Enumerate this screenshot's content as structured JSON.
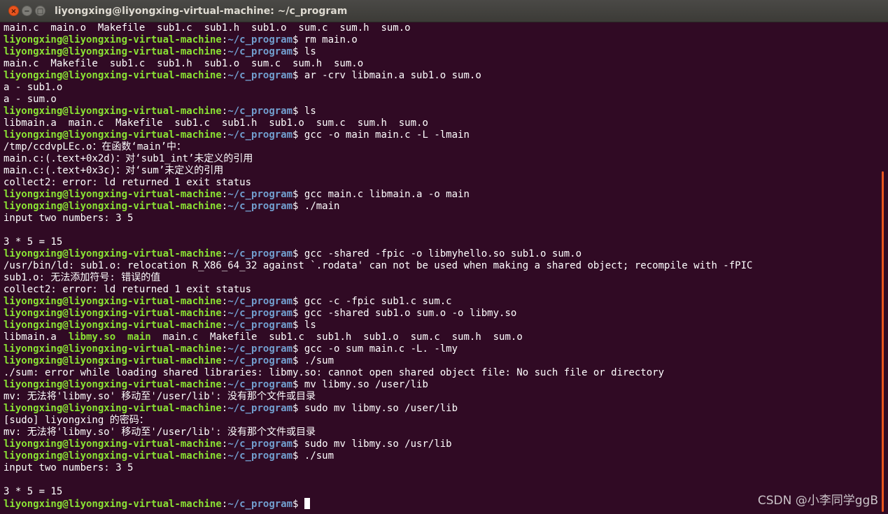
{
  "window": {
    "title": "liyongxing@liyongxing-virtual-machine: ~/c_program",
    "close_glyph": "×",
    "minimize_glyph": "−",
    "maximize_glyph": "□"
  },
  "prompt": {
    "user_host": "liyongxing@liyongxing-virtual-machine",
    "sep": ":",
    "path": "~/c_program",
    "symbol": "$ "
  },
  "lines": [
    {
      "type": "out",
      "text": "main.c  main.o  Makefile  sub1.c  sub1.h  sub1.o  sum.c  sum.h  sum.o"
    },
    {
      "type": "cmd",
      "text": "rm main.o"
    },
    {
      "type": "cmd",
      "text": "ls"
    },
    {
      "type": "out",
      "text": "main.c  Makefile  sub1.c  sub1.h  sub1.o  sum.c  sum.h  sum.o"
    },
    {
      "type": "cmd",
      "text": "ar -crv libmain.a sub1.o sum.o"
    },
    {
      "type": "out",
      "text": "a - sub1.o"
    },
    {
      "type": "out",
      "text": "a - sum.o"
    },
    {
      "type": "cmd",
      "text": "ls"
    },
    {
      "type": "out",
      "text": "libmain.a  main.c  Makefile  sub1.c  sub1.h  sub1.o  sum.c  sum.h  sum.o"
    },
    {
      "type": "cmd",
      "text": "gcc -o main main.c -L -lmain"
    },
    {
      "type": "out",
      "text": "/tmp/ccdvpLEc.o：在函数‘main’中："
    },
    {
      "type": "out",
      "text": "main.c:(.text+0x2d)：对‘sub1_int’未定义的引用"
    },
    {
      "type": "out",
      "text": "main.c:(.text+0x3c)：对‘sum’未定义的引用"
    },
    {
      "type": "out",
      "text": "collect2: error: ld returned 1 exit status"
    },
    {
      "type": "cmd",
      "text": "gcc main.c libmain.a -o main"
    },
    {
      "type": "cmd",
      "text": "./main"
    },
    {
      "type": "out",
      "text": "input two numbers: 3 5"
    },
    {
      "type": "out",
      "text": ""
    },
    {
      "type": "out",
      "text": "3 * 5 = 15"
    },
    {
      "type": "cmd",
      "text": "gcc -shared -fpic -o libmyhello.so sub1.o sum.o"
    },
    {
      "type": "out",
      "text": "/usr/bin/ld: sub1.o: relocation R_X86_64_32 against `.rodata' can not be used when making a shared object; recompile with -fPIC"
    },
    {
      "type": "out",
      "text": "sub1.o: 无法添加符号: 错误的值"
    },
    {
      "type": "out",
      "text": "collect2: error: ld returned 1 exit status"
    },
    {
      "type": "cmd",
      "text": "gcc -c -fpic sub1.c sum.c"
    },
    {
      "type": "cmd",
      "text": "gcc -shared sub1.o sum.o -o libmy.so"
    },
    {
      "type": "cmd",
      "text": "ls"
    },
    {
      "type": "ls",
      "parts": [
        {
          "t": "libmain.a  ",
          "c": "plain"
        },
        {
          "t": "libmy.so",
          "c": "exec"
        },
        {
          "t": "  ",
          "c": "plain"
        },
        {
          "t": "main",
          "c": "exec"
        },
        {
          "t": "  main.c  Makefile  sub1.c  sub1.h  sub1.o  sum.c  sum.h  sum.o",
          "c": "plain"
        }
      ]
    },
    {
      "type": "cmd",
      "text": "gcc -o sum main.c -L. -lmy"
    },
    {
      "type": "cmd",
      "text": "./sum"
    },
    {
      "type": "out",
      "text": "./sum: error while loading shared libraries: libmy.so: cannot open shared object file: No such file or directory"
    },
    {
      "type": "cmd",
      "text": "mv libmy.so /user/lib"
    },
    {
      "type": "out",
      "text": "mv: 无法将'libmy.so' 移动至'/user/lib': 没有那个文件或目录"
    },
    {
      "type": "cmd",
      "text": "sudo mv libmy.so /user/lib"
    },
    {
      "type": "out",
      "text": "[sudo] liyongxing 的密码："
    },
    {
      "type": "out",
      "text": "mv: 无法将'libmy.so' 移动至'/user/lib': 没有那个文件或目录"
    },
    {
      "type": "cmd",
      "text": "sudo mv libmy.so /usr/lib"
    },
    {
      "type": "cmd",
      "text": "./sum"
    },
    {
      "type": "out",
      "text": "input two numbers: 3 5"
    },
    {
      "type": "out",
      "text": ""
    },
    {
      "type": "out",
      "text": "3 * 5 = 15"
    },
    {
      "type": "cmd",
      "text": "",
      "cursor": true
    }
  ],
  "watermark": "CSDN @小李同学ggB",
  "colors": {
    "background": "#300a24",
    "user_host": "#8ae234",
    "path": "#729fcf",
    "text": "#ffffff",
    "scrollbar": "#e9541f"
  }
}
